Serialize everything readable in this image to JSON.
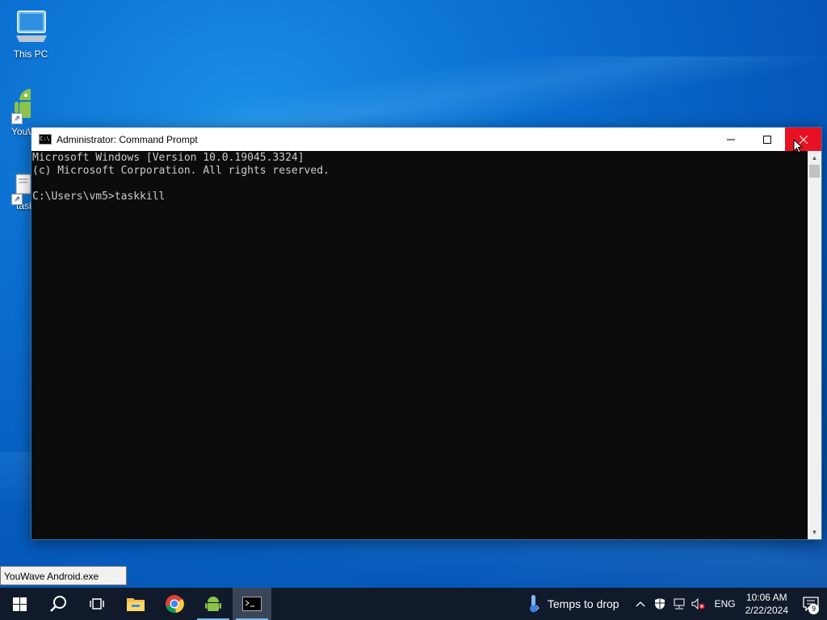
{
  "desktop": {
    "icons": [
      {
        "label": "This PC",
        "icon": "computer-icon"
      },
      {
        "label": "YouWave Android",
        "icon": "android-icon"
      },
      {
        "label": "taskkill",
        "icon": "file-shortcut-icon"
      }
    ]
  },
  "window": {
    "title": "Administrator: Command Prompt",
    "console_lines": [
      "Microsoft Windows [Version 10.0.19045.3324]",
      "(c) Microsoft Corporation. All rights reserved.",
      "",
      "C:\\Users\\vm5>taskkill"
    ],
    "close_color": "#e81123"
  },
  "tooltip": {
    "text": "YouWave Android.exe"
  },
  "taskbar": {
    "items": [
      "start",
      "search",
      "task-view",
      "file-explorer",
      "chrome",
      "youwave-android",
      "command-prompt"
    ],
    "weather": {
      "text": "Temps to drop",
      "icon": "thermometer-icon"
    },
    "language": "ENG",
    "time": "10:06 AM",
    "date": "2/22/2024",
    "notification_count": "9"
  }
}
